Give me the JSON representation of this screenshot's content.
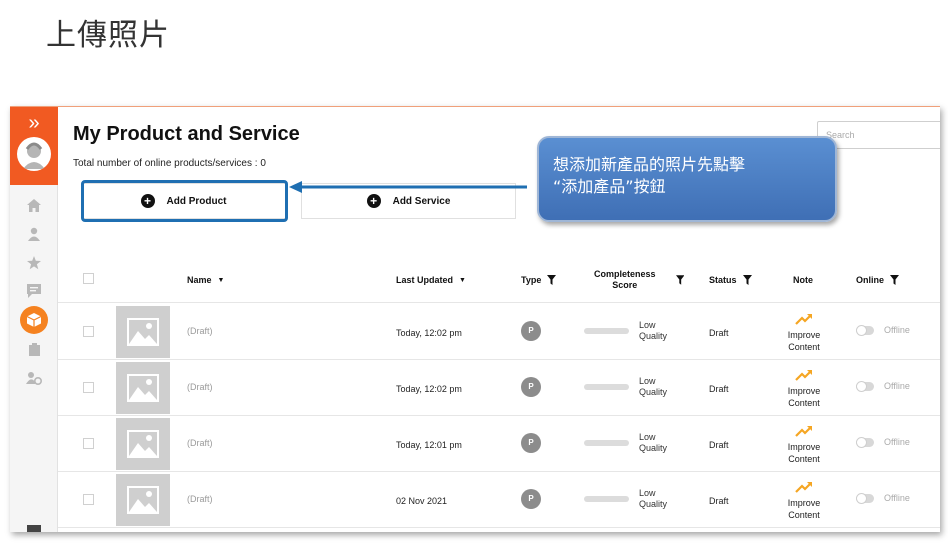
{
  "slide": {
    "title": "上傳照片"
  },
  "page": {
    "title": "My Product and Service",
    "total_count_text": "Total number of online products/services : 0",
    "search_placeholder": "Search"
  },
  "buttons": {
    "add_product": "Add Product",
    "add_service": "Add Service"
  },
  "table": {
    "headers": {
      "name": "Name",
      "last_updated": "Last Updated",
      "type": "Type",
      "completeness_line1": "Completeness",
      "completeness_line2": "Score",
      "status": "Status",
      "note": "Note",
      "online": "Online"
    },
    "rows": [
      {
        "name": "(Draft)",
        "last_updated": "Today, 12:02 pm",
        "type": "P",
        "score_line1": "Low",
        "score_line2": "Quality",
        "status": "Draft",
        "note_line1": "Improve",
        "note_line2": "Content",
        "online": "Offline"
      },
      {
        "name": "(Draft)",
        "last_updated": "Today, 12:02 pm",
        "type": "P",
        "score_line1": "Low",
        "score_line2": "Quality",
        "status": "Draft",
        "note_line1": "Improve",
        "note_line2": "Content",
        "online": "Offline"
      },
      {
        "name": "(Draft)",
        "last_updated": "Today, 12:01 pm",
        "type": "P",
        "score_line1": "Low",
        "score_line2": "Quality",
        "status": "Draft",
        "note_line1": "Improve",
        "note_line2": "Content",
        "online": "Offline"
      },
      {
        "name": "(Draft)",
        "last_updated": "02 Nov 2021",
        "type": "P",
        "score_line1": "Low",
        "score_line2": "Quality",
        "status": "Draft",
        "note_line1": "Improve",
        "note_line2": "Content",
        "online": "Offline"
      }
    ]
  },
  "callout": {
    "line1": "想添加新產品的照片先點擊",
    "line2": "“添加產品”按鈕"
  },
  "colors": {
    "brand_orange": "#f15a22",
    "callout_blue": "#4a7fc4",
    "highlight_blue": "#1f6fb2",
    "improve_orange": "#f5a623"
  }
}
